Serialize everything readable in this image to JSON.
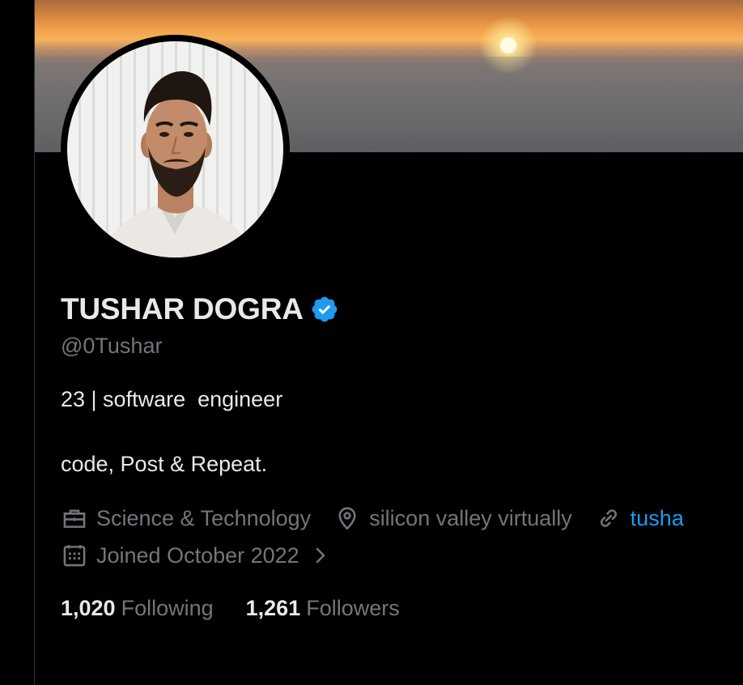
{
  "profile": {
    "name": "TUSHAR DOGRA",
    "handle": "@0Tushar",
    "bio_line1": "23 | software  engineer",
    "bio_line2": "code, Post & Repeat.",
    "category": "Science & Technology",
    "location": "silicon valley virtually",
    "website": "tusha",
    "joined": "Joined October 2022"
  },
  "stats": {
    "following_count": "1,020",
    "following_label": "Following",
    "followers_count": "1,261",
    "followers_label": "Followers"
  },
  "icons": {
    "verified": "verified-badge-icon",
    "category": "briefcase-icon",
    "location": "location-pin-icon",
    "website": "link-icon",
    "joined": "calendar-icon",
    "joined_more": "chevron-right-icon"
  },
  "colors": {
    "background": "#000000",
    "text_primary": "#e7e9ea",
    "text_secondary": "#71767b",
    "accent": "#1d9bf0"
  }
}
